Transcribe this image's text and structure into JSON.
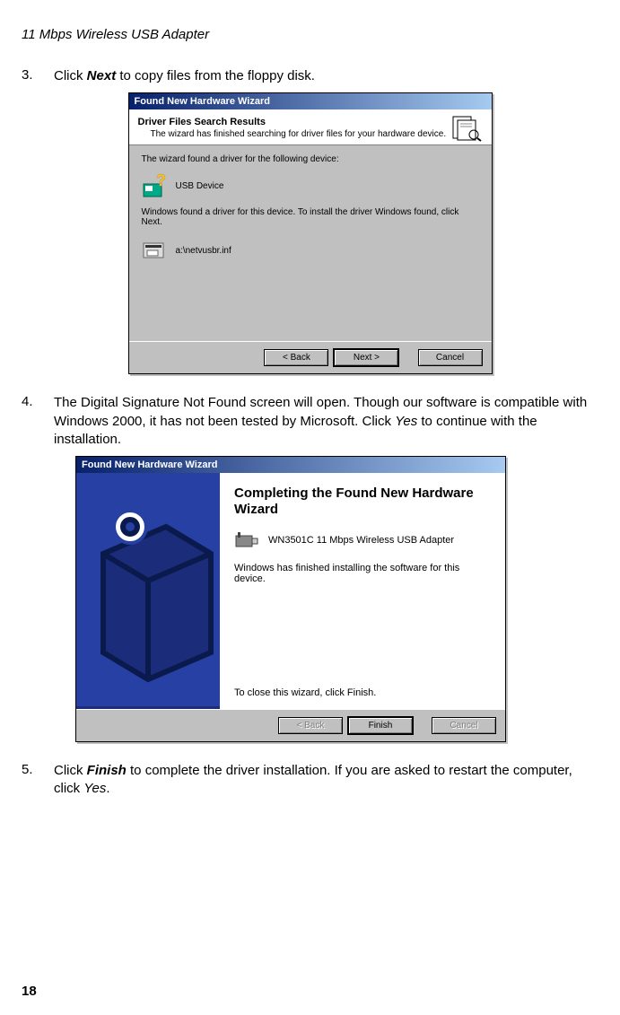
{
  "docHeader": "11 Mbps Wireless USB Adapter",
  "steps": {
    "s3": {
      "num": "3.",
      "pre": "Click ",
      "bold": "Next",
      "post": " to copy files from the floppy disk."
    },
    "s4": {
      "num": "4.",
      "textA": "The Digital Signature Not Found screen will open. Though our software is compatible with Windows 2000, it has not been tested by Microsoft. Click ",
      "yes": "Yes",
      "textB": " to continue with the installation."
    },
    "s5": {
      "num": "5.",
      "pre": "Click ",
      "bold": "Finish",
      "post": " to complete the driver installation. If you are asked to restart the computer, click ",
      "yes": "Yes",
      "dot": "."
    }
  },
  "wiz1": {
    "title": "Found New Hardware Wizard",
    "heading": "Driver Files Search Results",
    "sub": "The wizard has finished searching for driver files for your hardware device.",
    "line1": "The wizard found a driver for the following device:",
    "device": "USB Device",
    "note": "Windows found a driver for this device. To install the driver Windows found, click Next.",
    "inf": "a:\\netvusbr.inf",
    "back": "< Back",
    "next": "Next >",
    "cancel": "Cancel"
  },
  "wiz2": {
    "title": "Found New Hardware Wizard",
    "heading": "Completing the Found New Hardware Wizard",
    "device": "WN3501C 11 Mbps Wireless USB Adapter",
    "text": "Windows has finished installing the software for this device.",
    "close": "To close this wizard, click Finish.",
    "back": "< Back",
    "finish": "Finish",
    "cancel": "Cancel"
  },
  "pageNumber": "18"
}
